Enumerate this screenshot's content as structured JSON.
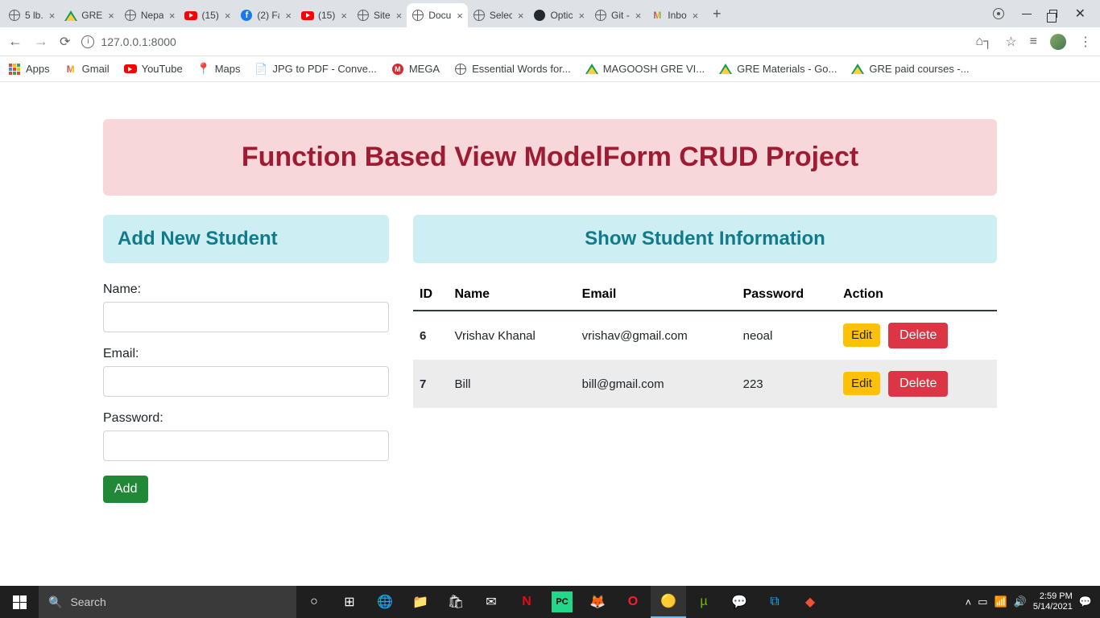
{
  "browser": {
    "tabs": [
      {
        "title": "5 lb."
      },
      {
        "title": "GRE"
      },
      {
        "title": "Nepa"
      },
      {
        "title": "(15)"
      },
      {
        "title": "(2) Fa"
      },
      {
        "title": "(15)"
      },
      {
        "title": "Site"
      },
      {
        "title": "Docu",
        "active": true
      },
      {
        "title": "Selec"
      },
      {
        "title": "Optic"
      },
      {
        "title": "Git -"
      },
      {
        "title": "Inbo"
      }
    ],
    "url": "127.0.0.1:8000",
    "bookmarks": [
      {
        "label": "Apps"
      },
      {
        "label": "Gmail"
      },
      {
        "label": "YouTube"
      },
      {
        "label": "Maps"
      },
      {
        "label": "JPG to PDF - Conve..."
      },
      {
        "label": "MEGA"
      },
      {
        "label": "Essential Words for..."
      },
      {
        "label": "MAGOOSH GRE VI..."
      },
      {
        "label": "GRE Materials - Go..."
      },
      {
        "label": "GRE paid courses -..."
      }
    ]
  },
  "page": {
    "title": "Function Based View ModelForm CRUD Project",
    "form_heading": "Add New Student",
    "table_heading": "Show Student Information",
    "labels": {
      "name": "Name:",
      "email": "Email:",
      "password": "Password:"
    },
    "buttons": {
      "add": "Add",
      "edit": "Edit",
      "delete": "Delete"
    },
    "columns": {
      "id": "ID",
      "name": "Name",
      "email": "Email",
      "password": "Password",
      "action": "Action"
    },
    "rows": [
      {
        "id": "6",
        "name": "Vrishav Khanal",
        "email": "vrishav@gmail.com",
        "password": "neoal"
      },
      {
        "id": "7",
        "name": "Bill",
        "email": "bill@gmail.com",
        "password": "223"
      }
    ]
  },
  "taskbar": {
    "search_placeholder": "Search",
    "time": "2:59 PM",
    "date": "5/14/2021"
  }
}
